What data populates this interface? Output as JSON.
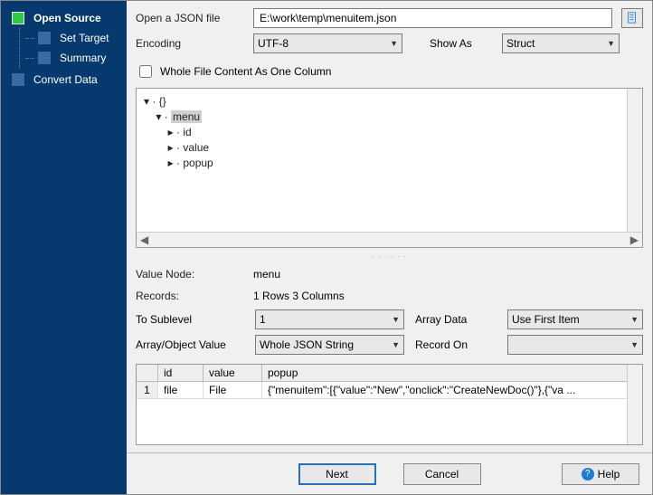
{
  "sidebar": {
    "items": [
      {
        "label": "Open Source",
        "active": true
      },
      {
        "label": "Set Target"
      },
      {
        "label": "Summary"
      },
      {
        "label": "Convert Data"
      }
    ]
  },
  "form": {
    "open_label": "Open a JSON file",
    "open_value": "E:\\work\\temp\\menuitem.json",
    "encoding_label": "Encoding",
    "encoding_value": "UTF-8",
    "showas_label": "Show As",
    "showas_value": "Struct",
    "whole_label": "Whole File Content As One Column"
  },
  "tree": {
    "root": "{}",
    "nodes": [
      "menu",
      "id",
      "value",
      "popup"
    ]
  },
  "info": {
    "valuenode_label": "Value Node:",
    "valuenode_value": "menu",
    "records_label": "Records:",
    "records_value": "1 Rows    3 Columns",
    "tosub_label": "To Sublevel",
    "tosub_value": "1",
    "arraydata_label": "Array Data",
    "arraydata_value": "Use First Item",
    "arrobj_label": "Array/Object Value",
    "arrobj_value": "Whole JSON String",
    "recordon_label": "Record On",
    "recordon_value": ""
  },
  "table": {
    "headers": [
      "",
      "id",
      "value",
      "popup"
    ],
    "rows": [
      {
        "n": "1",
        "id": "file",
        "value": "File",
        "popup": "{\"menuitem\":[{\"value\":\"New\",\"onclick\":\"CreateNewDoc()\"},{\"va ..."
      }
    ]
  },
  "footer": {
    "next": "Next",
    "cancel": "Cancel",
    "help": "Help"
  }
}
